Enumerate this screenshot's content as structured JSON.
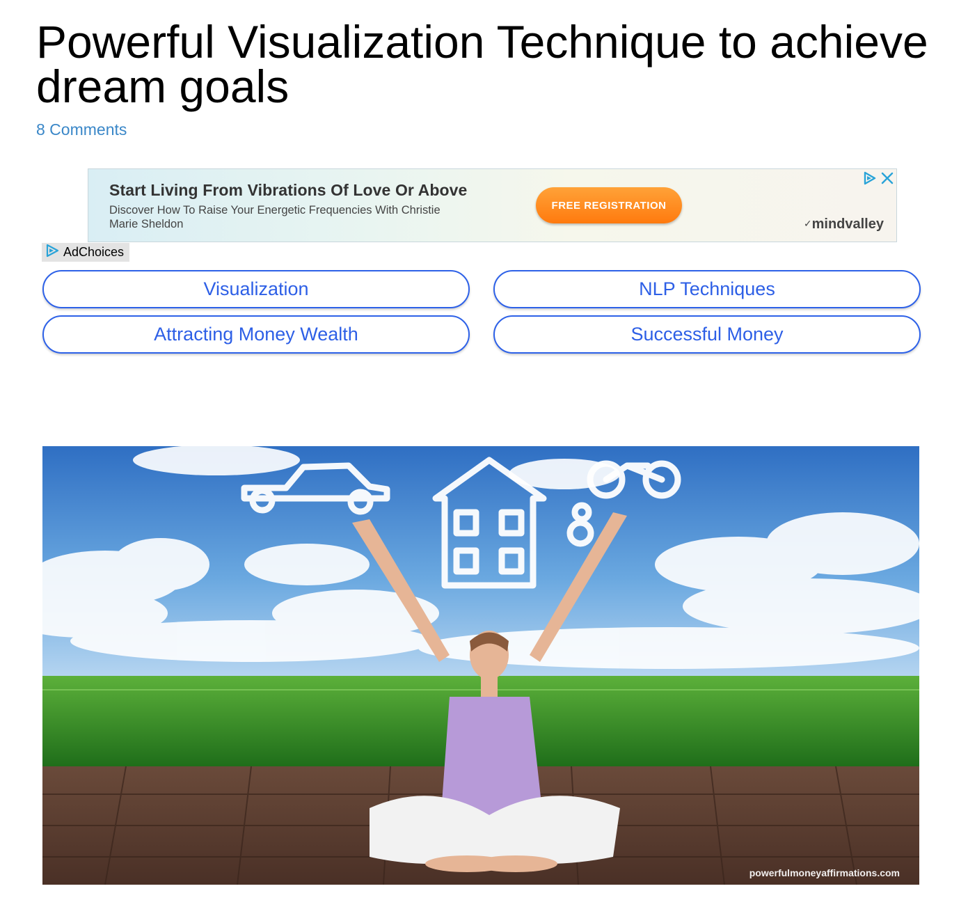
{
  "article": {
    "title": "Powerful Visualization Technique to achieve dream goals",
    "comments_link": "8 Comments"
  },
  "ad": {
    "headline": "Start Living From Vibrations Of Love Or Above",
    "description": "Discover How To Raise Your Energetic Frequencies With Christie Marie Sheldon",
    "cta_label": "FREE REGISTRATION",
    "brand": "mindvalley",
    "adchoices_label": "AdChoices",
    "colors": {
      "cta": "#ff8a1a",
      "adchoices_icon": "#29a3d8"
    }
  },
  "tags": [
    {
      "label": "Visualization"
    },
    {
      "label": "NLP Techniques"
    },
    {
      "label": "Attracting Money Wealth"
    },
    {
      "label": "Successful Money"
    }
  ],
  "hero": {
    "watermark": "powerfulmoneyaffirmations.com"
  },
  "colors": {
    "link": "#3a87c8",
    "tag_border": "#2d61e8",
    "tag_text": "#2d5fe6"
  }
}
